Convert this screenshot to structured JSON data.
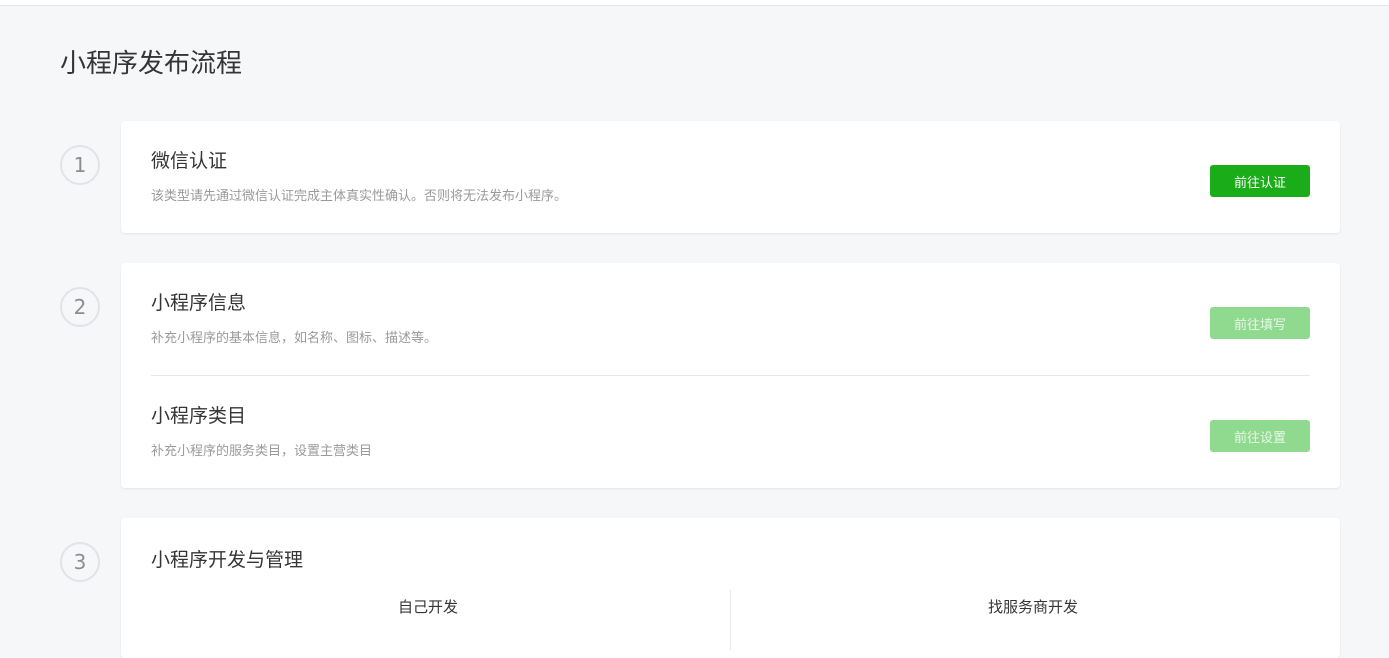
{
  "page": {
    "title": "小程序发布流程"
  },
  "steps": [
    {
      "number": "1",
      "items": [
        {
          "title": "微信认证",
          "description": "该类型请先通过微信认证完成主体真实性确认。否则将无法发布小程序。",
          "button": "前往认证",
          "button_state": "enabled"
        }
      ]
    },
    {
      "number": "2",
      "items": [
        {
          "title": "小程序信息",
          "description": "补充小程序的基本信息，如名称、图标、描述等。",
          "button": "前往填写",
          "button_state": "disabled"
        },
        {
          "title": "小程序类目",
          "description": "补充小程序的服务类目，设置主营类目",
          "button": "前往设置",
          "button_state": "disabled"
        }
      ]
    },
    {
      "number": "3",
      "title": "小程序开发与管理",
      "options": [
        {
          "label": "自己开发"
        },
        {
          "label": "找服务商开发"
        }
      ]
    }
  ],
  "colors": {
    "primary": "#1aad19",
    "primary_disabled": "#90da8f",
    "background": "#f6f7f9",
    "card": "#ffffff"
  }
}
